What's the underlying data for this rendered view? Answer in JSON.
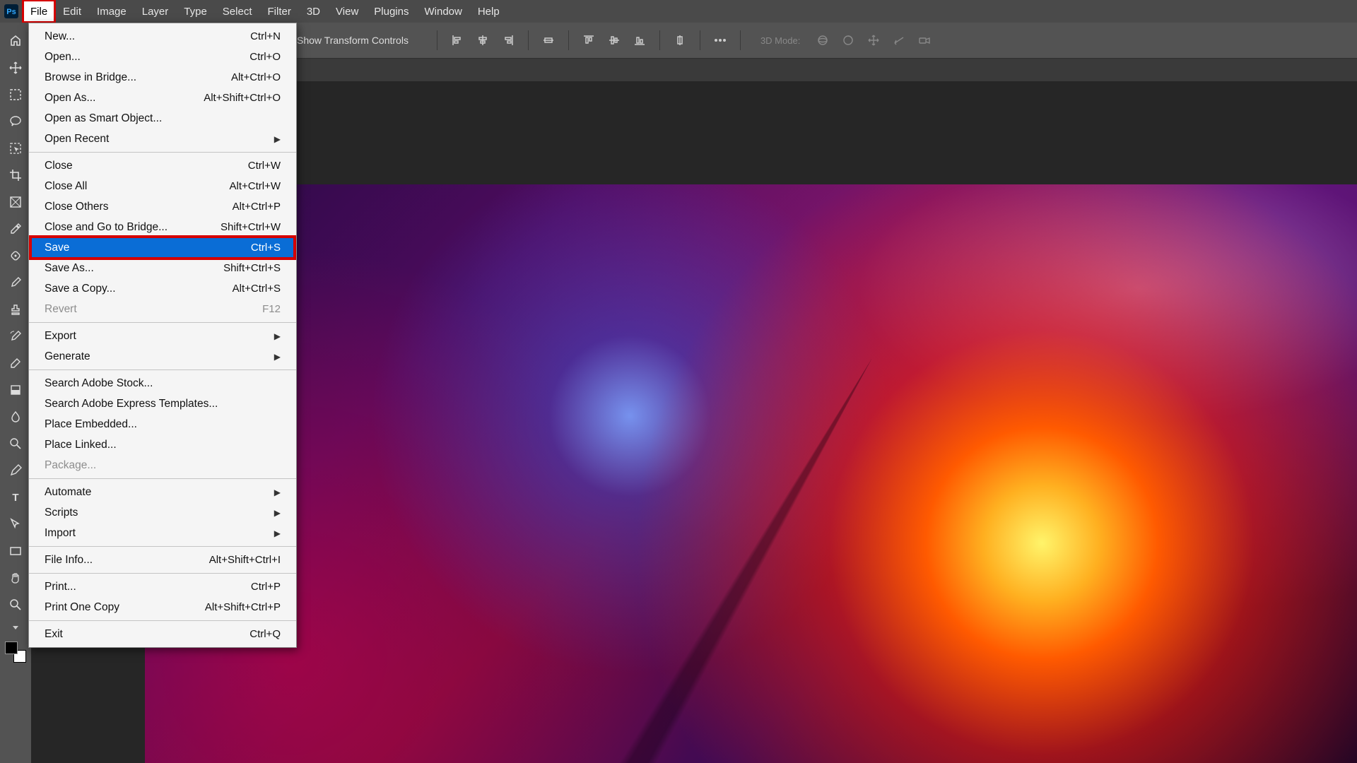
{
  "menubar": {
    "items": [
      "File",
      "Edit",
      "Image",
      "Layer",
      "Type",
      "Select",
      "Filter",
      "3D",
      "View",
      "Plugins",
      "Window",
      "Help"
    ],
    "open_index": 0
  },
  "options_bar": {
    "transform_label": "Show Transform Controls",
    "mode3d_label": "3D Mode:"
  },
  "file_menu": {
    "highlighted_index": 9,
    "groups": [
      [
        {
          "label": "New...",
          "shortcut": "Ctrl+N"
        },
        {
          "label": "Open...",
          "shortcut": "Ctrl+O"
        },
        {
          "label": "Browse in Bridge...",
          "shortcut": "Alt+Ctrl+O"
        },
        {
          "label": "Open As...",
          "shortcut": "Alt+Shift+Ctrl+O"
        },
        {
          "label": "Open as Smart Object..."
        },
        {
          "label": "Open Recent",
          "submenu": true
        }
      ],
      [
        {
          "label": "Close",
          "shortcut": "Ctrl+W"
        },
        {
          "label": "Close All",
          "shortcut": "Alt+Ctrl+W"
        },
        {
          "label": "Close Others",
          "shortcut": "Alt+Ctrl+P"
        },
        {
          "label": "Close and Go to Bridge...",
          "shortcut": "Shift+Ctrl+W"
        },
        {
          "label": "Save",
          "shortcut": "Ctrl+S"
        },
        {
          "label": "Save As...",
          "shortcut": "Shift+Ctrl+S"
        },
        {
          "label": "Save a Copy...",
          "shortcut": "Alt+Ctrl+S"
        },
        {
          "label": "Revert",
          "shortcut": "F12",
          "disabled": true
        }
      ],
      [
        {
          "label": "Export",
          "submenu": true
        },
        {
          "label": "Generate",
          "submenu": true
        }
      ],
      [
        {
          "label": "Search Adobe Stock..."
        },
        {
          "label": "Search Adobe Express Templates..."
        },
        {
          "label": "Place Embedded..."
        },
        {
          "label": "Place Linked..."
        },
        {
          "label": "Package...",
          "disabled": true
        }
      ],
      [
        {
          "label": "Automate",
          "submenu": true
        },
        {
          "label": "Scripts",
          "submenu": true
        },
        {
          "label": "Import",
          "submenu": true
        }
      ],
      [
        {
          "label": "File Info...",
          "shortcut": "Alt+Shift+Ctrl+I"
        }
      ],
      [
        {
          "label": "Print...",
          "shortcut": "Ctrl+P"
        },
        {
          "label": "Print One Copy",
          "shortcut": "Alt+Shift+Ctrl+P"
        }
      ],
      [
        {
          "label": "Exit",
          "shortcut": "Ctrl+Q"
        }
      ]
    ]
  },
  "tools": [
    "home-icon",
    "move-icon",
    "marquee-icon",
    "lasso-icon",
    "object-select-icon",
    "crop-icon",
    "frame-icon",
    "eyedropper-icon",
    "healing-icon",
    "brush-icon",
    "stamp-icon",
    "history-brush-icon",
    "eraser-icon",
    "paint-bucket-icon",
    "blur-icon",
    "dodge-icon",
    "pen-icon",
    "type-icon",
    "path-select-icon",
    "rectangle-icon",
    "hand-icon",
    "zoom-icon"
  ]
}
